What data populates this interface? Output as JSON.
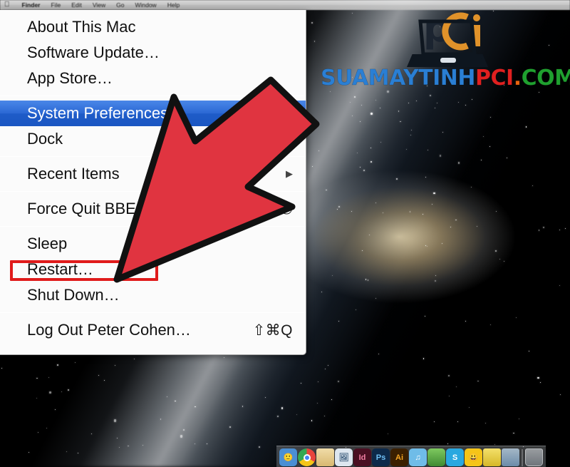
{
  "menubar": {
    "apple_icon": "apple-logo-icon",
    "items": [
      {
        "label": "Finder",
        "bold": true
      },
      {
        "label": "File",
        "bold": false
      },
      {
        "label": "Edit",
        "bold": false
      },
      {
        "label": "View",
        "bold": false
      },
      {
        "label": "Go",
        "bold": false
      },
      {
        "label": "Window",
        "bold": false
      },
      {
        "label": "Help",
        "bold": false
      }
    ]
  },
  "apple_menu": {
    "groups": [
      {
        "items": [
          {
            "label": "About This Mac",
            "shortcut": "",
            "selected": false,
            "submenu": false
          },
          {
            "label": "Software Update…",
            "shortcut": "",
            "selected": false,
            "submenu": false
          },
          {
            "label": "App Store…",
            "shortcut": "",
            "selected": false,
            "submenu": false
          }
        ]
      },
      {
        "items": [
          {
            "label": "System Preferences…",
            "shortcut": "",
            "selected": true,
            "submenu": false
          },
          {
            "label": "Dock",
            "shortcut": "",
            "selected": false,
            "submenu": true
          }
        ]
      },
      {
        "items": [
          {
            "label": "Recent Items",
            "shortcut": "",
            "selected": false,
            "submenu": true
          }
        ]
      },
      {
        "items": [
          {
            "label": "Force Quit BBEdit…",
            "shortcut": "⌥⌘⎋",
            "selected": false,
            "submenu": false
          }
        ]
      },
      {
        "items": [
          {
            "label": "Sleep",
            "shortcut": "",
            "selected": false,
            "submenu": false
          },
          {
            "label": "Restart…",
            "shortcut": "",
            "selected": false,
            "submenu": false
          },
          {
            "label": "Shut Down…",
            "shortcut": "",
            "selected": false,
            "submenu": false
          }
        ]
      },
      {
        "items": [
          {
            "label": "Log Out Peter Cohen…",
            "shortcut": "⇧⌘Q",
            "selected": false,
            "submenu": false
          }
        ]
      }
    ]
  },
  "annotations": {
    "arrow_color": "#e03440",
    "arrow_outline_color": "#111111",
    "highlight_box_color": "#e01b1b",
    "highlight_target": "Restart…"
  },
  "watermark": {
    "logo_text": "pci",
    "text_parts": [
      {
        "text": "SUAMAYTINH",
        "color": "#2a7fd4"
      },
      {
        "text": "PCI",
        "color": "#e02020"
      },
      {
        "text": ".",
        "color": "#e8640f"
      },
      {
        "text": "COM",
        "color": "#1fa02f"
      }
    ]
  },
  "dock": {
    "icons": [
      {
        "name": "finder-icon",
        "glyph": "🙂",
        "bg": "#4a8fd4",
        "color": "#ffffff"
      },
      {
        "name": "chrome-icon",
        "glyph": "",
        "bg": "#f5f5f5",
        "color": "#2a7fd4"
      },
      {
        "name": "folder-icon",
        "glyph": "",
        "bg": "#e6c884",
        "color": "#8a6a2a"
      },
      {
        "name": "preview-icon",
        "glyph": "🖼",
        "bg": "#dde6ef",
        "color": "#3a5a7a"
      },
      {
        "name": "indesign-icon",
        "glyph": "Id",
        "bg": "#4a0f22",
        "color": "#f37fa4"
      },
      {
        "name": "photoshop-icon",
        "glyph": "Ps",
        "bg": "#0d2a4a",
        "color": "#6fc0f5"
      },
      {
        "name": "illustrator-icon",
        "glyph": "Ai",
        "bg": "#3b2000",
        "color": "#f5a623"
      },
      {
        "name": "itunes-icon",
        "glyph": "♫",
        "bg": "#6fbce8",
        "color": "#ffffff"
      },
      {
        "name": "app-icon-green",
        "glyph": "",
        "bg": "#5aa84a",
        "color": "#ffffff"
      },
      {
        "name": "skype-icon",
        "glyph": "S",
        "bg": "#2aa8e0",
        "color": "#ffffff"
      },
      {
        "name": "smiley-icon",
        "glyph": "😃",
        "bg": "#f5c518",
        "color": "#4a3a00"
      },
      {
        "name": "sticky-note-icon",
        "glyph": "",
        "bg": "#e8d24a",
        "color": "#6a5a10"
      },
      {
        "name": "downloads-stack-icon",
        "glyph": "",
        "bg": "#9fc6e0",
        "color": "#ffffff"
      },
      {
        "name": "trash-icon",
        "glyph": "",
        "bg": "#c8ccd0",
        "color": "#55595d"
      }
    ]
  }
}
